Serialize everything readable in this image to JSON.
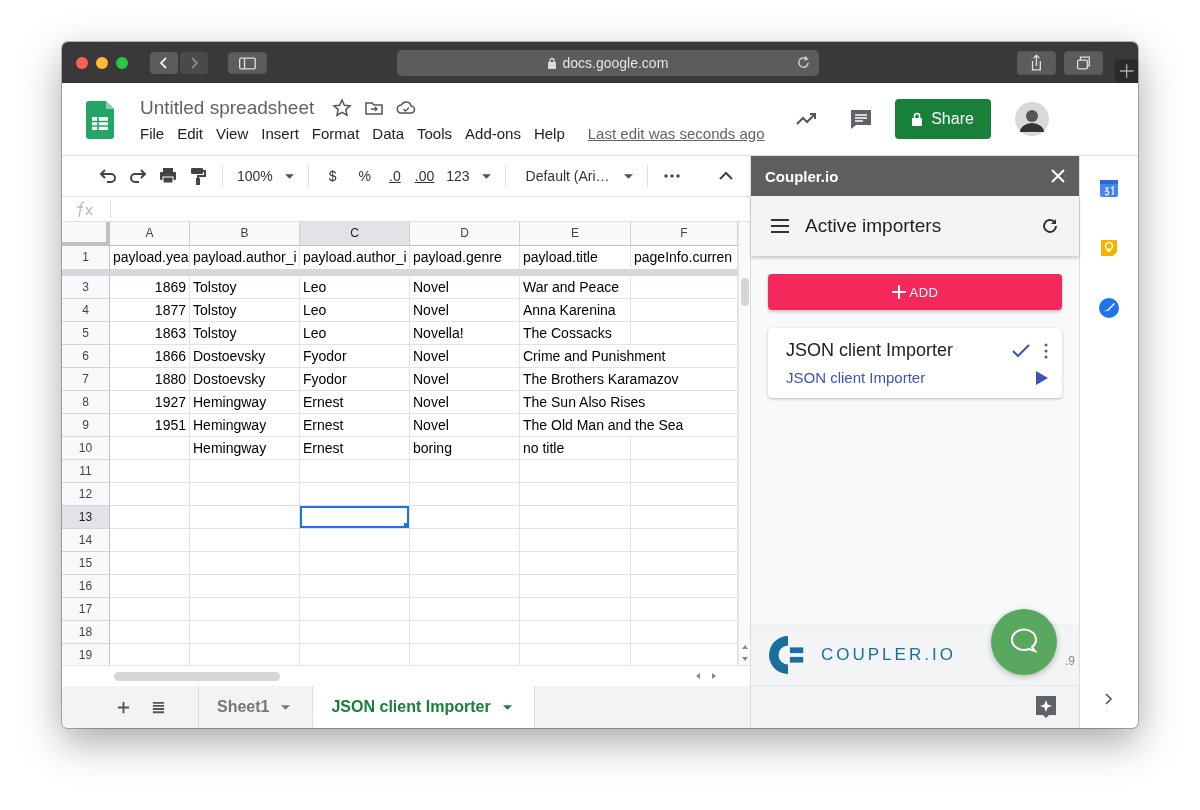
{
  "browser": {
    "address": "docs.google.com"
  },
  "document": {
    "title": "Untitled spreadsheet",
    "menus": [
      "File",
      "Edit",
      "View",
      "Insert",
      "Format",
      "Data",
      "Tools",
      "Add-ons",
      "Help"
    ],
    "last_edit": "Last edit was seconds ago",
    "share_button": "Share"
  },
  "toolbar": {
    "zoom": "100%",
    "currency": "$",
    "percent": "%",
    "decrease_decimals": ".0",
    "increase_decimals": ".00",
    "number_format": "123",
    "font": "Default (Ari…"
  },
  "sheet": {
    "columns": [
      {
        "label": "A",
        "selected": false
      },
      {
        "label": "B",
        "selected": false
      },
      {
        "label": "C",
        "selected": true
      },
      {
        "label": "D",
        "selected": false
      },
      {
        "label": "E",
        "selected": false
      },
      {
        "label": "F",
        "selected": false
      }
    ],
    "rows": [
      {
        "number": "1",
        "kind": "header",
        "selected": false,
        "cells": {
          "a": "payload.yea",
          "b": "payload.author_i",
          "c": "payload.author_i",
          "d": "payload.genre",
          "e": "payload.title",
          "f": "pageInfo.curren"
        }
      },
      {
        "number": "3",
        "kind": "data",
        "selected": false,
        "cells": {
          "a": "1869",
          "b": "Tolstoy",
          "c": "Leo",
          "d": "Novel",
          "e": "War and Peace"
        }
      },
      {
        "number": "4",
        "kind": "data",
        "selected": false,
        "cells": {
          "a": "1877",
          "b": "Tolstoy",
          "c": "Leo",
          "d": "Novel",
          "e": "Anna Karenina"
        }
      },
      {
        "number": "5",
        "kind": "data",
        "selected": false,
        "cells": {
          "a": "1863",
          "b": "Tolstoy",
          "c": "Leo",
          "d": "Novella!",
          "e": "The Cossacks"
        }
      },
      {
        "number": "6",
        "kind": "data",
        "selected": false,
        "cells": {
          "a": "1866",
          "b": "Dostoevsky",
          "c": "Fyodor",
          "d": "Novel",
          "e": "Crime and Punishment"
        },
        "e_spills_into_f": true
      },
      {
        "number": "7",
        "kind": "data",
        "selected": false,
        "cells": {
          "a": "1880",
          "b": "Dostoevsky",
          "c": "Fyodor",
          "d": "Novel",
          "e": "The Brothers Karamazov"
        },
        "e_spills_into_f": true
      },
      {
        "number": "8",
        "kind": "data",
        "selected": false,
        "cells": {
          "a": "1927",
          "b": "Hemingway",
          "c": "Ernest",
          "d": "Novel",
          "e": "The Sun Also Rises"
        },
        "e_spills_into_f": true
      },
      {
        "number": "9",
        "kind": "data",
        "selected": false,
        "cells": {
          "a": "1951",
          "b": "Hemingway",
          "c": "Ernest",
          "d": "Novel",
          "e": "The Old Man and the Sea"
        },
        "e_spills_into_f": true
      },
      {
        "number": "10",
        "kind": "data",
        "selected": false,
        "cells": {
          "b": "Hemingway",
          "c": "Ernest",
          "d": "boring",
          "e": "no title"
        }
      },
      {
        "number": "11",
        "kind": "data",
        "selected": false,
        "cells": {}
      },
      {
        "number": "12",
        "kind": "data",
        "selected": false,
        "cells": {}
      },
      {
        "number": "13",
        "kind": "data",
        "selected": true,
        "cells": {}
      },
      {
        "number": "14",
        "kind": "data",
        "selected": false,
        "cells": {}
      },
      {
        "number": "15",
        "kind": "data",
        "selected": false,
        "cells": {}
      },
      {
        "number": "16",
        "kind": "data",
        "selected": false,
        "cells": {}
      },
      {
        "number": "17",
        "kind": "data",
        "selected": false,
        "cells": {}
      },
      {
        "number": "18",
        "kind": "data",
        "selected": false,
        "cells": {}
      },
      {
        "number": "19",
        "kind": "data",
        "selected": false,
        "cells": {}
      }
    ],
    "tabs": [
      {
        "label": "Sheet1",
        "selected": false
      },
      {
        "label": "JSON client Importer",
        "selected": true
      }
    ]
  },
  "sidebar": {
    "title": "Coupler.io",
    "heading": "Active importers",
    "add_button": "ADD",
    "importers": [
      {
        "title": "JSON client Importer",
        "link": "JSON client Importer",
        "checked": true
      }
    ],
    "logo_text": "COUPLER.IO",
    "version": ".9"
  }
}
